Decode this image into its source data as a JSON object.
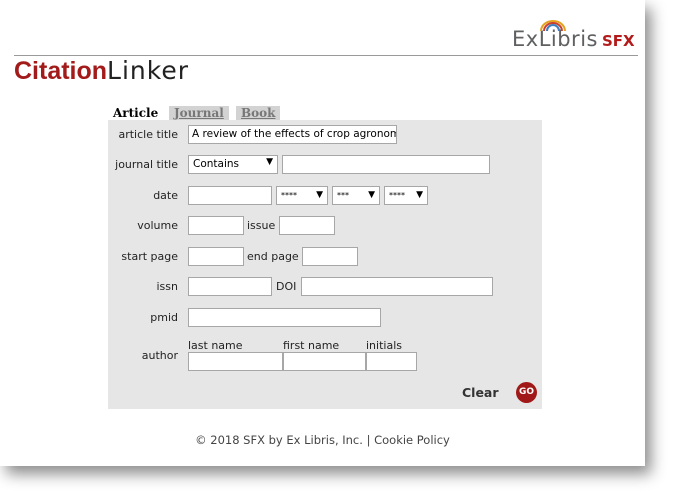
{
  "header": {
    "logo_ex": "ExLibris",
    "logo_sfx": "SFX",
    "title_bold": "Citation",
    "title_rest": "Linker"
  },
  "tabs": [
    {
      "label": "Article",
      "active": true
    },
    {
      "label": "Journal",
      "active": false
    },
    {
      "label": "Book",
      "active": false
    }
  ],
  "form": {
    "article_title_label": "article title",
    "article_title_value": "A review of the effects of crop agronomy",
    "journal_title_label": "journal title",
    "journal_title_select": "Contains",
    "journal_title_value": "",
    "date_label": "date",
    "date_year": "****",
    "date_month": "***",
    "date_day": "****",
    "volume_label": "volume",
    "issue_label": "issue",
    "start_page_label": "start page",
    "end_page_label": "end page",
    "issn_label": "issn",
    "doi_label": "DOI",
    "pmid_label": "pmid",
    "author_label": "author",
    "last_name_label": "last name",
    "first_name_label": "first name",
    "initials_label": "initials",
    "clear_label": "Clear",
    "go_label": "GO"
  },
  "footer": {
    "text": "© 2018 SFX by Ex Libris, Inc. | Cookie Policy"
  },
  "colors": {
    "brand_red": "#a01818",
    "panel_bg": "#e6e6e6"
  }
}
